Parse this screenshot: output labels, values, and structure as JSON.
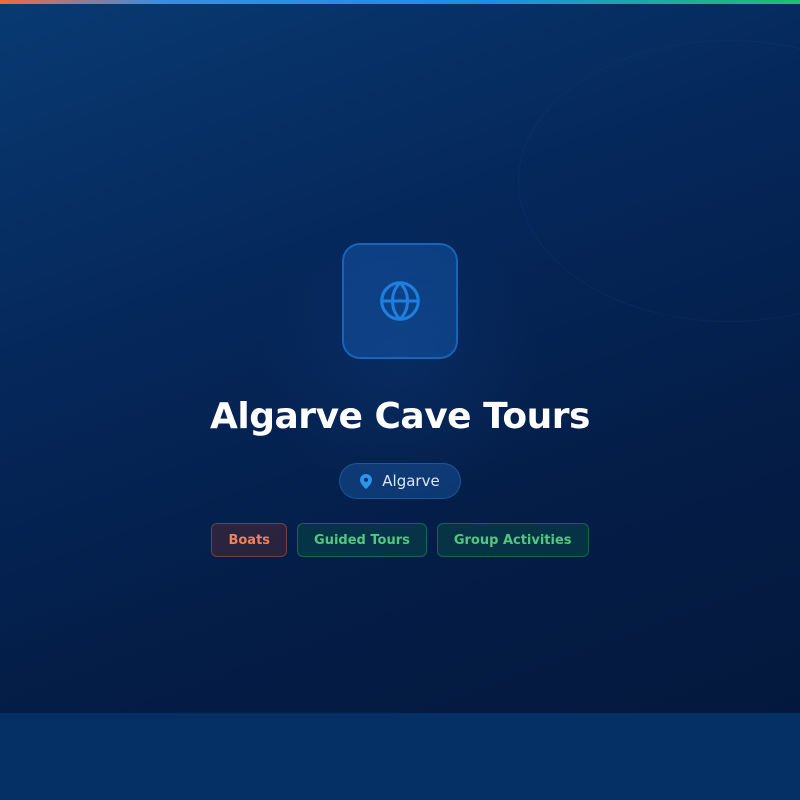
{
  "header": {
    "accent_colors": [
      "#f26a3d",
      "#1a8fe6",
      "#1fbf6e"
    ]
  },
  "card": {
    "icon": "globe-icon",
    "title": "Algarve Cave Tours",
    "location": {
      "icon": "map-pin-icon",
      "label": "Algarve"
    },
    "tags": [
      {
        "label": "Boats",
        "color": "#f0825a"
      },
      {
        "label": "Guided Tours",
        "color": "#52c77f"
      },
      {
        "label": "Group Activities",
        "color": "#52c77f"
      }
    ]
  }
}
